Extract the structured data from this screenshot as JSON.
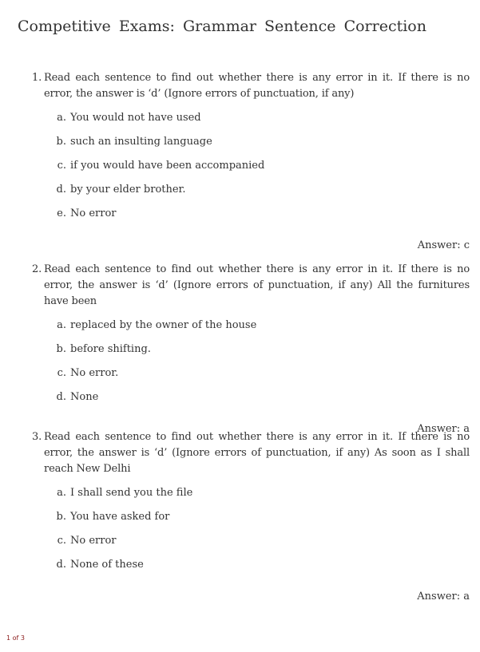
{
  "document": {
    "title": "Competitive Exams: Grammar Sentence Correction",
    "page_number": "1 of 3"
  },
  "questions": [
    {
      "number": "1.",
      "stem": "Read each sentence to find out whether there is any error in it. If there is no error, the answer is ‘d’ (Ignore errors of punctuation, if any)",
      "options": [
        {
          "letter": "a.",
          "text": "You would not have used"
        },
        {
          "letter": "b.",
          "text": "such an insulting language"
        },
        {
          "letter": "c.",
          "text": "if you would have been accompanied"
        },
        {
          "letter": "d.",
          "text": "by your elder brother."
        },
        {
          "letter": "e.",
          "text": "No error"
        }
      ],
      "answer": "Answer: c"
    },
    {
      "number": "2.",
      "stem": "Read each sentence to find out whether there is any error in it. If there is no error, the answer is ‘d’ (Ignore errors of punctuation, if any) All the furnitures have been",
      "options": [
        {
          "letter": "a.",
          "text": "replaced by the owner of the house"
        },
        {
          "letter": "b.",
          "text": "before shifting."
        },
        {
          "letter": "c.",
          "text": "No error."
        },
        {
          "letter": "d.",
          "text": "None"
        }
      ],
      "answer": "Answer: a"
    },
    {
      "number": "3.",
      "stem": "Read each sentence to find out whether there is any error in it. If there is no error, the answer is ‘d’ (Ignore errors of punctuation, if any) As soon as I shall reach New Delhi",
      "options": [
        {
          "letter": "a.",
          "text": "I shall send you the file"
        },
        {
          "letter": "b.",
          "text": "You have asked for"
        },
        {
          "letter": "c.",
          "text": "No error"
        },
        {
          "letter": "d.",
          "text": "None of these"
        }
      ],
      "answer": "Answer: a"
    }
  ]
}
